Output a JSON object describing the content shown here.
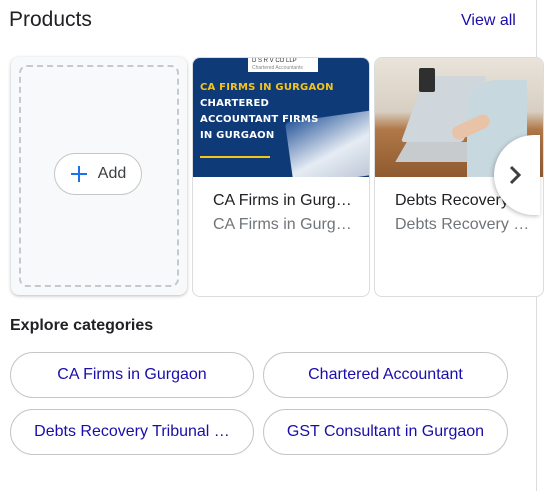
{
  "header": {
    "title": "Products",
    "view_all": "View all"
  },
  "add_card": {
    "label": "Add",
    "icon": "plus-icon"
  },
  "products": [
    {
      "title": "CA Firms in Gurg…",
      "subtitle": "CA Firms in Gurg…",
      "image": {
        "logo_text": "D S R V    CO LLP",
        "logo_sub": "Chartered Accountants",
        "line1": "CA FIRMS IN GURGAON",
        "line2": "CHARTERED",
        "line3": "ACCOUNTANT FIRMS",
        "line4": "IN GURGAON"
      }
    },
    {
      "title": "Debts Recovery …",
      "subtitle": "Debts Recovery …"
    }
  ],
  "carousel": {
    "next_icon": "chevron-right-icon"
  },
  "explore": {
    "heading": "Explore categories",
    "chips": [
      "CA Firms in Gurgaon",
      "Chartered Accountant",
      "Debts Recovery Tribunal …",
      "GST Consultant in Gurgaon"
    ]
  },
  "colors": {
    "link": "#1a0dab",
    "plus": "#1a73e8",
    "muted": "#70757a",
    "border": "#dadce0"
  }
}
